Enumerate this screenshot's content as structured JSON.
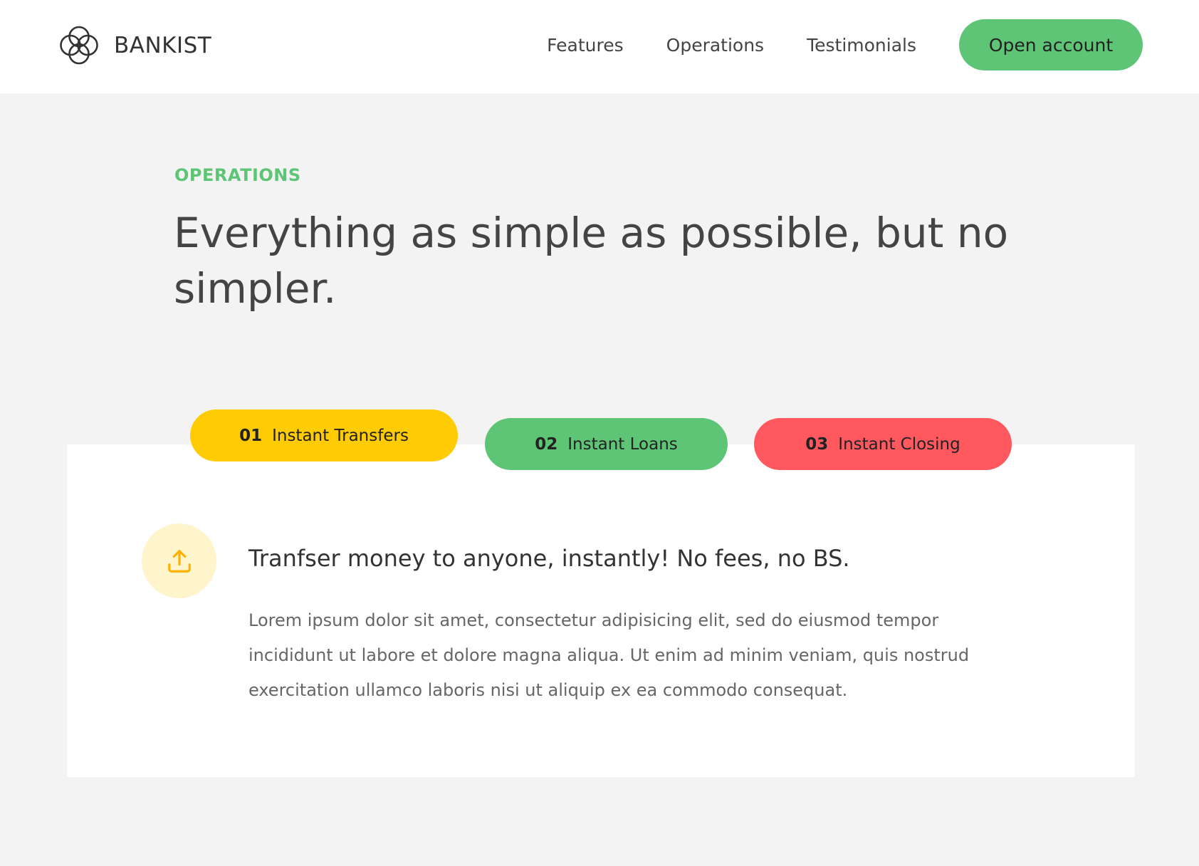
{
  "brand": {
    "name": "BANKIST",
    "accent_green": "#5ec576",
    "accent_yellow": "#ffcb03",
    "accent_red": "#ff585f",
    "icon": "four-circles-logo-icon"
  },
  "nav": {
    "links": [
      "Features",
      "Operations",
      "Testimonials"
    ],
    "cta_label": "Open account"
  },
  "section": {
    "eyebrow": "OPERATIONS",
    "heading": "Everything as simple as possible, but no simpler."
  },
  "tabs": [
    {
      "number": "01",
      "label": "Instant Transfers",
      "color": "#ffcb03",
      "active": true
    },
    {
      "number": "02",
      "label": "Instant Loans",
      "color": "#5ec576",
      "active": false
    },
    {
      "number": "03",
      "label": "Instant Closing",
      "color": "#ff585f",
      "active": false
    }
  ],
  "content": {
    "icon": "upload-icon",
    "title": "Tranfser money to anyone, instantly! No fees, no BS.",
    "text": "Lorem ipsum dolor sit amet, consectetur adipisicing elit, sed do eiusmod tempor incididunt ut labore et dolore magna aliqua. Ut enim ad minim veniam, quis nostrud exercitation ullamco laboris nisi ut aliquip ex ea commodo consequat."
  }
}
